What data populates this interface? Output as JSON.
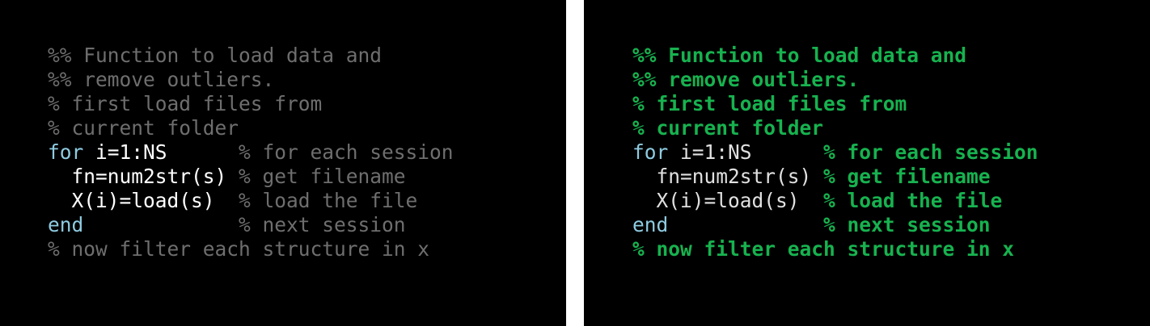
{
  "colors": {
    "background": "#000000",
    "separator": "#ffffff",
    "left_comment": "#6e6e6e",
    "keyword": "#8ecbe0",
    "code": "#ffffff",
    "right_comment": "#17b24f",
    "right_code": "#e0e0e0"
  },
  "panels": [
    {
      "id": "left",
      "lines": [
        [
          {
            "t": "%% Function to load data and",
            "k": "comment"
          }
        ],
        [
          {
            "t": "%% remove outliers.",
            "k": "comment"
          }
        ],
        [
          {
            "t": "% first load files from",
            "k": "comment"
          }
        ],
        [
          {
            "t": "% current folder",
            "k": "comment"
          }
        ],
        [
          {
            "t": "for",
            "k": "keyword"
          },
          {
            "t": " i=1:NS      ",
            "k": "code"
          },
          {
            "t": "% for each session",
            "k": "comment"
          }
        ],
        [
          {
            "t": "  fn=num2str(s) ",
            "k": "code"
          },
          {
            "t": "% get filename",
            "k": "comment"
          }
        ],
        [
          {
            "t": "  X(i)=load(s)  ",
            "k": "code"
          },
          {
            "t": "% load the file",
            "k": "comment"
          }
        ],
        [
          {
            "t": "end",
            "k": "keyword"
          },
          {
            "t": "             ",
            "k": "code"
          },
          {
            "t": "% next session",
            "k": "comment"
          }
        ],
        [
          {
            "t": "% now filter each structure in x",
            "k": "comment"
          }
        ]
      ]
    },
    {
      "id": "right",
      "lines": [
        [
          {
            "t": "%% Function to load data and",
            "k": "comment"
          }
        ],
        [
          {
            "t": "%% remove outliers.",
            "k": "comment"
          }
        ],
        [
          {
            "t": "% first load files from",
            "k": "comment"
          }
        ],
        [
          {
            "t": "% current folder",
            "k": "comment"
          }
        ],
        [
          {
            "t": "for",
            "k": "keyword"
          },
          {
            "t": " i=1:NS      ",
            "k": "code"
          },
          {
            "t": "% for each session",
            "k": "comment"
          }
        ],
        [
          {
            "t": "  fn=num2str(s) ",
            "k": "code"
          },
          {
            "t": "% get filename",
            "k": "comment"
          }
        ],
        [
          {
            "t": "  X(i)=load(s)  ",
            "k": "code"
          },
          {
            "t": "% load the file",
            "k": "comment"
          }
        ],
        [
          {
            "t": "end",
            "k": "keyword"
          },
          {
            "t": "             ",
            "k": "code"
          },
          {
            "t": "% next session",
            "k": "comment"
          }
        ],
        [
          {
            "t": "% now filter each structure in x",
            "k": "comment"
          }
        ]
      ]
    }
  ]
}
